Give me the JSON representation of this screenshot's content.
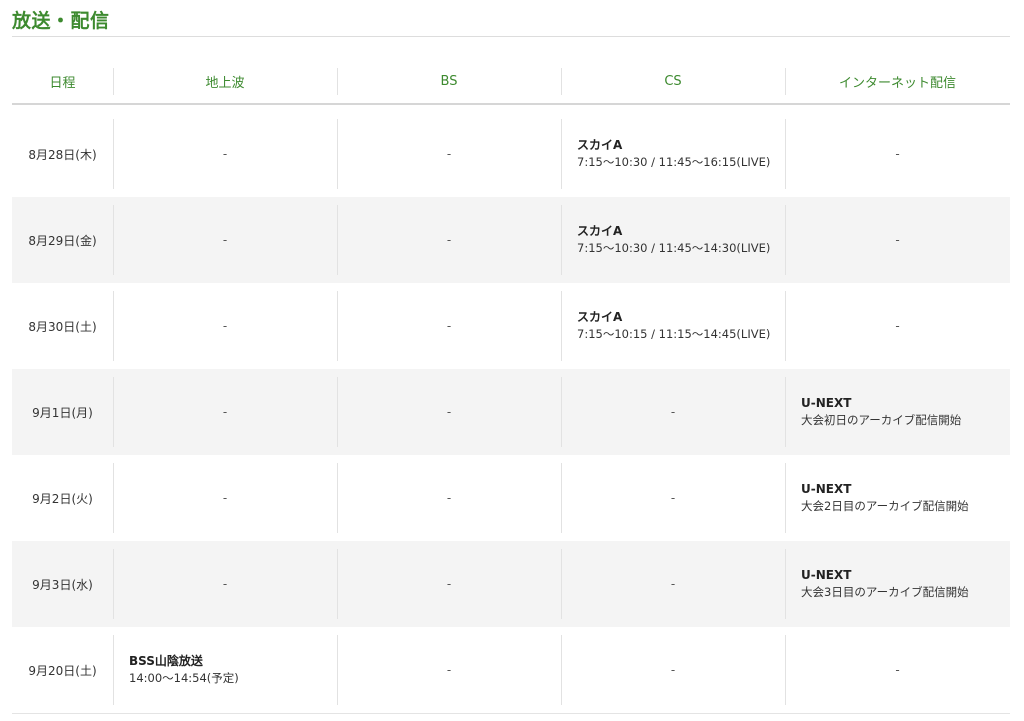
{
  "section_title": "放送・配信",
  "headers": [
    "日程",
    "地上波",
    "BS",
    "CS",
    "インターネット配信"
  ],
  "rows": [
    {
      "date": "8月28日(木)",
      "cells": [
        {
          "dash": "-"
        },
        {
          "dash": "-"
        },
        {
          "name": "スカイA",
          "detail": "7:15〜10:30 / 11:45〜16:15(LIVE)"
        },
        {
          "dash": "-"
        }
      ]
    },
    {
      "date": "8月29日(金)",
      "cells": [
        {
          "dash": "-"
        },
        {
          "dash": "-"
        },
        {
          "name": "スカイA",
          "detail": "7:15〜10:30 / 11:45〜14:30(LIVE)"
        },
        {
          "dash": "-"
        }
      ]
    },
    {
      "date": "8月30日(土)",
      "cells": [
        {
          "dash": "-"
        },
        {
          "dash": "-"
        },
        {
          "name": "スカイA",
          "detail": "7:15〜10:15 / 11:15〜14:45(LIVE)"
        },
        {
          "dash": "-"
        }
      ]
    },
    {
      "date": "9月1日(月)",
      "cells": [
        {
          "dash": "-"
        },
        {
          "dash": "-"
        },
        {
          "dash": "-"
        },
        {
          "name": "U-NEXT",
          "detail": "大会初日のアーカイブ配信開始"
        }
      ]
    },
    {
      "date": "9月2日(火)",
      "cells": [
        {
          "dash": "-"
        },
        {
          "dash": "-"
        },
        {
          "dash": "-"
        },
        {
          "name": "U-NEXT",
          "detail": "大会2日目のアーカイブ配信開始"
        }
      ]
    },
    {
      "date": "9月3日(水)",
      "cells": [
        {
          "dash": "-"
        },
        {
          "dash": "-"
        },
        {
          "dash": "-"
        },
        {
          "name": "U-NEXT",
          "detail": "大会3日目のアーカイブ配信開始"
        }
      ]
    },
    {
      "date": "9月20日(土)",
      "cells": [
        {
          "name": "BSS山陰放送",
          "detail": "14:00〜14:54(予定)"
        },
        {
          "dash": "-"
        },
        {
          "dash": "-"
        },
        {
          "dash": "-"
        }
      ]
    }
  ],
  "colors": {
    "accent": "#3d8a2f",
    "alt_row": "#f4f4f4",
    "rule": "#dddddd"
  }
}
